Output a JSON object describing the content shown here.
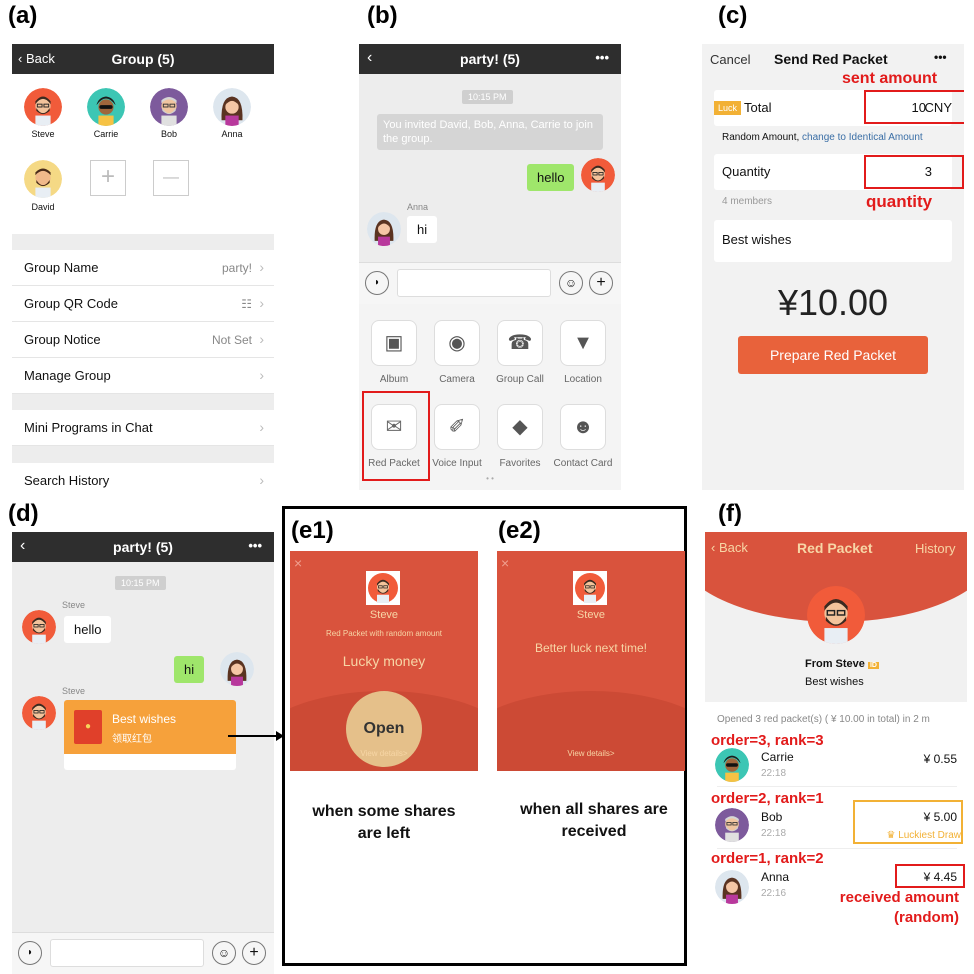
{
  "labels": {
    "a": "(a)",
    "b": "(b)",
    "c": "(c)",
    "d": "(d)",
    "e1": "(e1)",
    "e2": "(e2)",
    "f": "(f)"
  },
  "a": {
    "back": "Back",
    "title": "Group (5)",
    "members": [
      "Steve",
      "Carrie",
      "Bob",
      "Anna",
      "David"
    ],
    "plus": "+",
    "minus": "—",
    "rows": [
      {
        "label": "Group Name",
        "value": "party!"
      },
      {
        "label": "Group QR Code",
        "value": "☷"
      },
      {
        "label": "Group Notice",
        "value": "Not Set"
      },
      {
        "label": "Manage Group",
        "value": ""
      },
      {
        "label": "Mini Programs in Chat",
        "value": ""
      },
      {
        "label": "Search History",
        "value": ""
      }
    ]
  },
  "b": {
    "title": "party! (5)",
    "more": "•••",
    "time": "10:15 PM",
    "system": "You invited David, Bob, Anna, Carrie to join the group.",
    "hello": "hello",
    "anna": "Anna",
    "hi": "hi",
    "grid": [
      {
        "label": "Album",
        "icon": "image-icon"
      },
      {
        "label": "Camera",
        "icon": "camera-icon"
      },
      {
        "label": "Group Call",
        "icon": "phone-icon"
      },
      {
        "label": "Location",
        "icon": "pin-icon"
      },
      {
        "label": "Red Packet",
        "icon": "envelope-icon"
      },
      {
        "label": "Voice Input",
        "icon": "mic-icon"
      },
      {
        "label": "Favorites",
        "icon": "cube-icon"
      },
      {
        "label": "Contact Card",
        "icon": "person-icon"
      }
    ],
    "dots": "• •"
  },
  "c": {
    "cancel": "Cancel",
    "title": "Send Red Packet",
    "more": "•••",
    "luck": "Luck",
    "total": "Total",
    "amount": "10",
    "unit": "CNY",
    "random": "Random Amount, ",
    "change": "change to Identical Amount",
    "quantity": "Quantity",
    "qty": "3",
    "members": "4 members",
    "wishes": "Best wishes",
    "big": "¥10.00",
    "prepare": "Prepare Red Packet",
    "ann_sent": "sent amount",
    "ann_qty": "quantity"
  },
  "d": {
    "title": "party! (5)",
    "more": "•••",
    "time": "10:15 PM",
    "steve": "Steve",
    "hello": "hello",
    "hi": "hi",
    "steve2": "Steve",
    "wishes": "Best wishes",
    "claim": "领取红包"
  },
  "e1": {
    "name": "Steve",
    "sub": "Red Packet with random amount",
    "lucky": "Lucky money",
    "open": "Open",
    "details": "View details>",
    "caption": "when some shares are left"
  },
  "e2": {
    "name": "Steve",
    "msg": "Better luck next time!",
    "details": "View details>",
    "caption": "when all shares are received"
  },
  "f": {
    "back": "Back",
    "title": "Red Packet",
    "history": "History",
    "from": "From Steve",
    "badge": "ID",
    "wishes": "Best wishes",
    "opened": "Opened 3 red packet(s) ( ¥ 10.00 in total) in 2 m",
    "entries": [
      {
        "order": "order=3, rank=3",
        "name": "Carrie",
        "time": "22:18",
        "amount": "¥ 0.55"
      },
      {
        "order": "order=2, rank=1",
        "name": "Bob",
        "time": "22:18",
        "amount": "¥ 5.00",
        "lucky": "Luckiest Draw"
      },
      {
        "order": "order=1, rank=2",
        "name": "Anna",
        "time": "22:16",
        "amount": "¥ 4.45"
      }
    ],
    "ann": "received amount (random)"
  }
}
